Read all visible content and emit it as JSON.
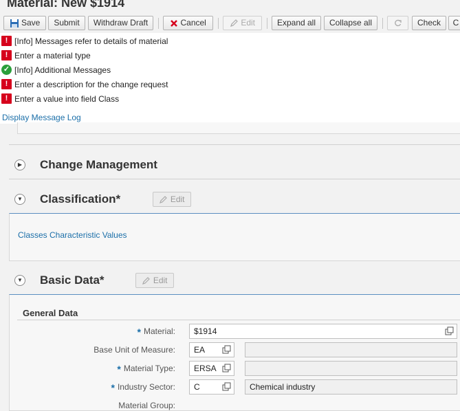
{
  "header": {
    "title": "Material: New $1914"
  },
  "toolbar": {
    "save": "Save",
    "submit": "Submit",
    "withdraw": "Withdraw Draft",
    "cancel": "Cancel",
    "edit": "Edit",
    "expand_all": "Expand all",
    "collapse_all": "Collapse all",
    "check": "Check",
    "overflow": "C"
  },
  "messages": {
    "items": [
      {
        "type": "error",
        "icon": "error-icon",
        "text": "[Info] Messages refer to details of material"
      },
      {
        "type": "error",
        "icon": "error-icon",
        "text": "Enter a material type"
      },
      {
        "type": "success",
        "icon": "check-icon",
        "text": "[Info] Additional Messages"
      },
      {
        "type": "error",
        "icon": "error-icon",
        "text": "Enter a description for the change request"
      },
      {
        "type": "error",
        "icon": "error-icon",
        "text": "Enter a value into field Class"
      }
    ],
    "log_link": "Display Message Log"
  },
  "sections": {
    "change_management": {
      "title": "Change Management",
      "expanded": false
    },
    "classification": {
      "title": "Classification*",
      "edit": "Edit",
      "expanded": true,
      "link": "Classes Characteristic Values"
    },
    "basic_data": {
      "title": "Basic Data*",
      "edit": "Edit",
      "expanded": true
    }
  },
  "general_data": {
    "title": "General Data",
    "material": {
      "label": "Material:",
      "required": true,
      "value": "$1914"
    },
    "base_unit": {
      "label": "Base Unit of Measure:",
      "required": false,
      "value": "EA",
      "desc": ""
    },
    "material_type": {
      "label": "Material Type:",
      "required": true,
      "value": "ERSA",
      "desc": ""
    },
    "industry_sector": {
      "label": "Industry Sector:",
      "required": true,
      "value": "C",
      "desc": "Chemical industry"
    },
    "material_group": {
      "label": "Material Group:"
    }
  },
  "colors": {
    "accent": "#1a6ea8",
    "error": "#d6001c",
    "success": "#2b9f3b"
  }
}
